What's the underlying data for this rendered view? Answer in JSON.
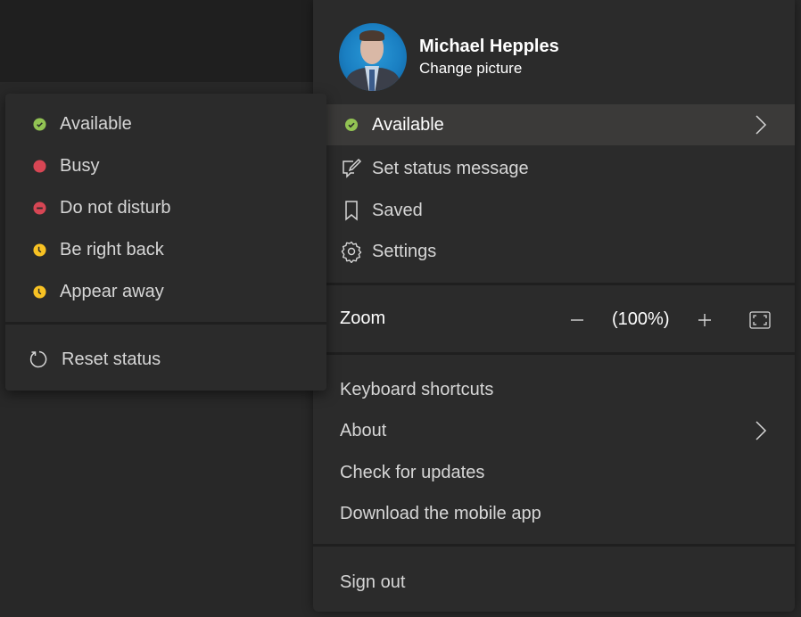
{
  "profile": {
    "name": "Michael Hepples",
    "change_picture": "Change picture"
  },
  "menu": {
    "status": {
      "label": "Available",
      "color": "#92c353"
    },
    "items": [
      {
        "label": "Set status message",
        "icon": "edit-message-icon"
      },
      {
        "label": "Saved",
        "icon": "bookmark-icon"
      },
      {
        "label": "Settings",
        "icon": "gear-icon"
      }
    ],
    "zoom": {
      "label": "Zoom",
      "value": "(100%)"
    },
    "links": [
      {
        "label": "Keyboard shortcuts"
      },
      {
        "label": "About",
        "has_submenu": true
      },
      {
        "label": "Check for updates"
      },
      {
        "label": "Download the mobile app"
      }
    ],
    "sign_out": "Sign out"
  },
  "status_submenu": {
    "options": [
      {
        "label": "Available",
        "status": "available",
        "color": "#92c353"
      },
      {
        "label": "Busy",
        "status": "busy",
        "color": "#c4314b"
      },
      {
        "label": "Do not disturb",
        "status": "dnd",
        "color": "#c4314b"
      },
      {
        "label": "Be right back",
        "status": "brb",
        "color": "#f8c223"
      },
      {
        "label": "Appear away",
        "status": "away",
        "color": "#f8c223"
      }
    ],
    "reset": "Reset status"
  }
}
